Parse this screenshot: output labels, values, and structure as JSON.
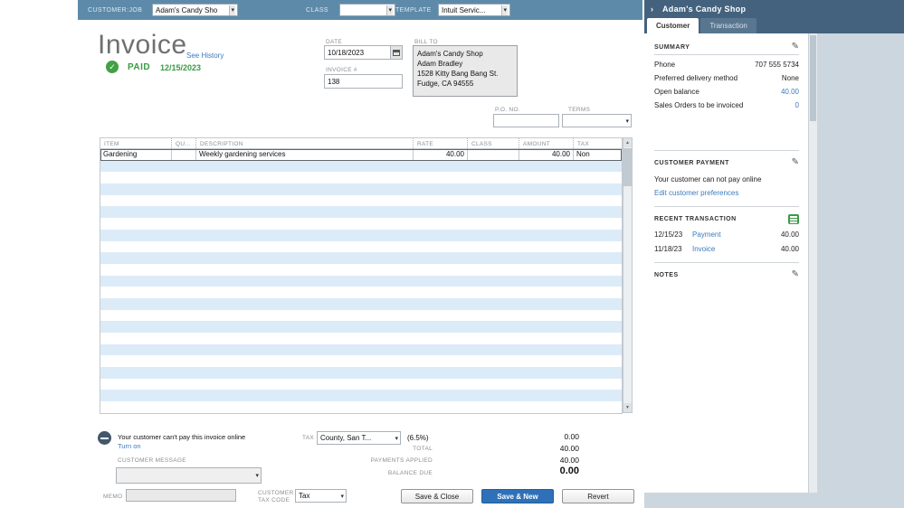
{
  "colors": {
    "toolbar_bg": "#5e8aa9",
    "panel_header_bg": "#44627e",
    "row_alt_bg": "#dcebf8",
    "link_blue": "#3a7cbe",
    "paid_green": "#3b9a43",
    "primary_button_bg": "#2e71b8"
  },
  "toolbar": {
    "customer_job_label": "CUSTOMER:JOB",
    "customer_job_value": "Adam's Candy Sho",
    "class_label": "CLASS",
    "class_value": "",
    "template_label": "TEMPLATE",
    "template_value": "Intuit Servic..."
  },
  "invoice": {
    "title": "Invoice",
    "see_history": "See History",
    "paid_label": "PAID",
    "paid_date": "12/15/2023",
    "date_label": "DATE",
    "date_value": "10/18/2023",
    "invoice_no_label": "INVOICE #",
    "invoice_no_value": "138",
    "bill_to_label": "BILL TO",
    "bill_to_lines": [
      "Adam's Candy Shop",
      "Adam Bradley",
      "1528 Kitty Bang Bang St.",
      "Fudge, CA 94555"
    ],
    "po_no_label": "P.O. NO.",
    "po_no_value": "",
    "terms_label": "TERMS",
    "terms_value": ""
  },
  "table": {
    "columns": [
      "ITEM",
      "QU...",
      "DESCRIPTION",
      "RATE",
      "CLASS",
      "AMOUNT",
      "TAX"
    ],
    "rows": [
      {
        "item": "Gardening",
        "qty": "",
        "description": "Weekly gardening services",
        "rate": "40.00",
        "class": "",
        "amount": "40.00",
        "tax": "Non"
      }
    ],
    "empty_row_count": 22
  },
  "footer": {
    "online_pay_message": "Your customer can't pay this invoice online",
    "turn_on_link": "Turn on",
    "tax_label": "TAX",
    "tax_value": "County, San T...",
    "tax_rate": "(6.5%)",
    "tax_amount": "0.00",
    "total_label": "TOTAL",
    "total_value": "40.00",
    "payments_applied_label": "PAYMENTS APPLIED",
    "payments_applied_value": "40.00",
    "balance_due_label": "BALANCE DUE",
    "balance_due_value": "0.00",
    "customer_message_label": "CUSTOMER MESSAGE",
    "customer_message_value": "",
    "memo_label": "MEMO",
    "memo_value": "",
    "customer_tax_code_label": "CUSTOMER TAX CODE",
    "customer_tax_code_value": "Tax",
    "save_close_button": "Save & Close",
    "save_new_button": "Save & New",
    "revert_button": "Revert"
  },
  "sidebar": {
    "title": "Adam's Candy Shop",
    "tabs": [
      {
        "label": "Customer",
        "active": true
      },
      {
        "label": "Transaction",
        "active": false
      }
    ],
    "summary": {
      "heading": "SUMMARY",
      "rows": [
        {
          "label": "Phone",
          "value": "707 555 5734",
          "link": false
        },
        {
          "label": "Preferred delivery method",
          "value": "None",
          "link": false
        },
        {
          "label": "Open balance",
          "value": "40.00",
          "link": true
        },
        {
          "label": "Sales Orders to be invoiced",
          "value": "0",
          "link": true
        }
      ]
    },
    "customer_payment": {
      "heading": "CUSTOMER PAYMENT",
      "message": "Your customer can not pay online",
      "edit_link": "Edit customer preferences"
    },
    "recent_transaction": {
      "heading": "RECENT TRANSACTION",
      "rows": [
        {
          "date": "12/15/23",
          "type": "Payment",
          "amount": "40.00"
        },
        {
          "date": "11/18/23",
          "type": "Invoice",
          "amount": "40.00"
        }
      ]
    },
    "notes_heading": "NOTES"
  }
}
